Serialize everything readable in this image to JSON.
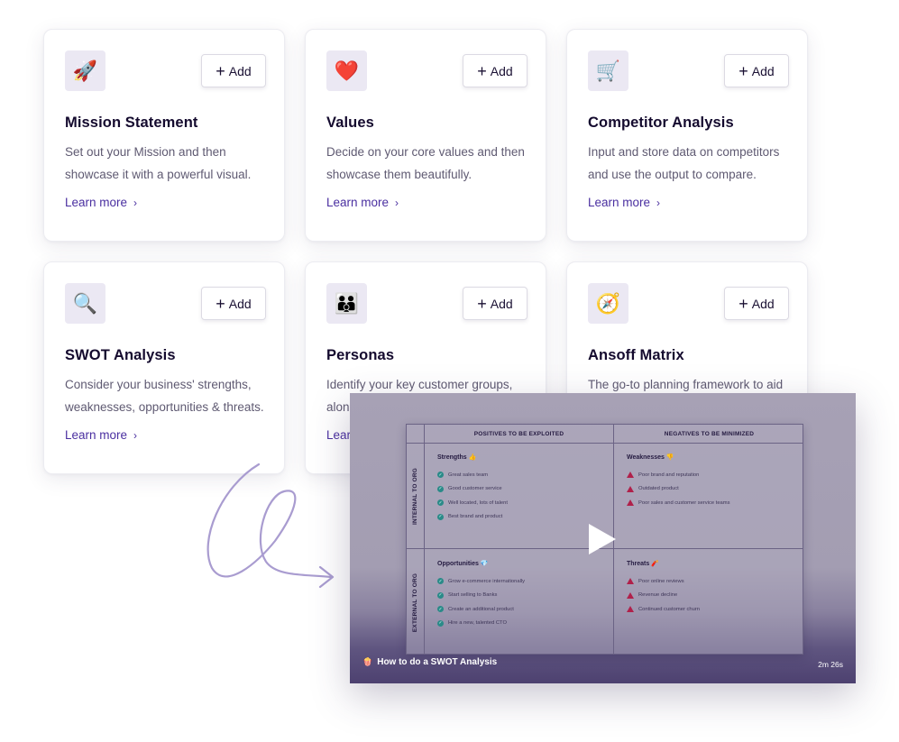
{
  "cards": [
    {
      "icon": "rocket-icon",
      "icon_glyph": "🚀",
      "add_label": "Add",
      "title": "Mission Statement",
      "description": "Set out your Mission and then showcase it with a powerful visual.",
      "link": "Learn more"
    },
    {
      "icon": "heart-icon",
      "icon_glyph": "❤️",
      "add_label": "Add",
      "title": "Values",
      "description": "Decide on your core values and then showcase them beautifully.",
      "link": "Learn more"
    },
    {
      "icon": "shopping-cart-icon",
      "icon_glyph": "🛒",
      "add_label": "Add",
      "title": "Competitor Analysis",
      "description": "Input and store data on competitors and use the output to compare.",
      "link": "Learn more"
    },
    {
      "icon": "magnifying-glass-icon",
      "icon_glyph": "🔍",
      "add_label": "Add",
      "title": "SWOT Analysis",
      "description": "Consider your business' strengths, weaknesses, opportunities & threats.",
      "link": "Learn more"
    },
    {
      "icon": "family-icon",
      "icon_glyph": "👪",
      "add_label": "Add",
      "title": "Personas",
      "description": "Identify your key customer groups, alon",
      "link": "Lear"
    },
    {
      "icon": "compass-icon",
      "icon_glyph": "🧭",
      "add_label": "Add",
      "title": "Ansoff Matrix",
      "description": "The go-to planning framework to aid",
      "link": ""
    }
  ],
  "video": {
    "title": "How to do a SWOT Analysis",
    "duration": "2m 26s",
    "swot": {
      "col_headers": [
        "POSITIVES TO BE EXPLOITED",
        "NEGATIVES TO BE MINIMIZED"
      ],
      "row_headers": [
        "INTERNAL TO ORG",
        "EXTERNAL TO ORG"
      ],
      "strengths": {
        "title": "Strengths",
        "icon": "👍",
        "items": [
          "Great sales team",
          "Good customer service",
          "Well located, lots of talent",
          "Best brand and product"
        ]
      },
      "weaknesses": {
        "title": "Weaknesses",
        "icon": "👎",
        "items": [
          "Poor brand and reputation",
          "Outdated product",
          "Poor sales and customer service teams"
        ]
      },
      "opportunities": {
        "title": "Opportunities",
        "icon": "💎",
        "items": [
          "Grow e-commerce internationally",
          "Start selling to Banks",
          "Create an additional product",
          "Hire a new, talented CTO"
        ]
      },
      "threats": {
        "title": "Threats",
        "icon": "🧨",
        "items": [
          "Poor online reviews",
          "Revenue decline",
          "Continued customer churn"
        ]
      }
    }
  },
  "colors": {
    "accent_link": "#4a2fa0",
    "icon_bg": "#ebe8f3",
    "doodle": "#a99cd0",
    "check": "#2a8a88",
    "warn": "#b0204a"
  }
}
